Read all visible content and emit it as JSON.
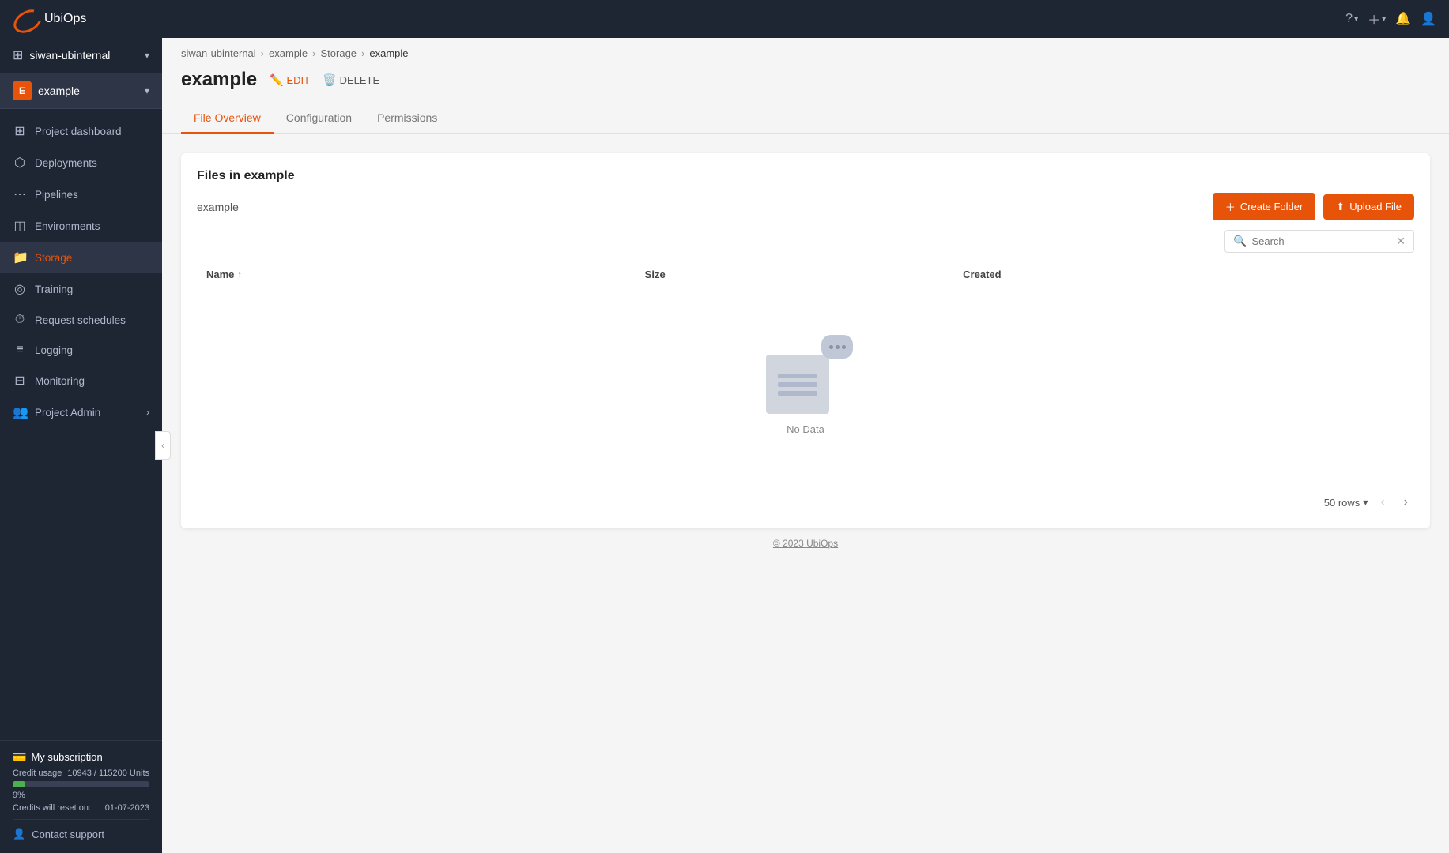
{
  "topnav": {
    "appTitle": "UbiOps",
    "helpLabel": "Help",
    "addLabel": "Add",
    "notificationsLabel": "Notifications",
    "profileLabel": "Profile"
  },
  "sidebar": {
    "orgName": "siwan-ubinternal",
    "projectName": "example",
    "projectInitial": "E",
    "navItems": [
      {
        "id": "project-dashboard",
        "label": "Project dashboard",
        "icon": "⊞"
      },
      {
        "id": "deployments",
        "label": "Deployments",
        "icon": "⬡"
      },
      {
        "id": "pipelines",
        "label": "Pipelines",
        "icon": "⋯"
      },
      {
        "id": "environments",
        "label": "Environments",
        "icon": "◫"
      },
      {
        "id": "storage",
        "label": "Storage",
        "icon": "📁",
        "active": true
      },
      {
        "id": "training",
        "label": "Training",
        "icon": "◎"
      },
      {
        "id": "request-schedules",
        "label": "Request schedules",
        "icon": "⏱"
      },
      {
        "id": "logging",
        "label": "Logging",
        "icon": "≡"
      },
      {
        "id": "monitoring",
        "label": "Monitoring",
        "icon": "⊟"
      },
      {
        "id": "project-admin",
        "label": "Project Admin",
        "icon": "👥",
        "hasChevron": true
      }
    ],
    "subscription": {
      "title": "My subscription",
      "creditLabel": "Credit usage",
      "creditValue": "10943 / 115200 Units",
      "creditPct": "9%",
      "creditFill": 9,
      "resetLabel": "Credits will reset on:",
      "resetDate": "01-07-2023"
    },
    "contactSupport": "Contact support"
  },
  "breadcrumb": {
    "items": [
      "siwan-ubinternal",
      "example",
      "Storage",
      "example"
    ]
  },
  "page": {
    "title": "example",
    "editLabel": "EDIT",
    "deleteLabel": "DELETE"
  },
  "tabs": [
    {
      "id": "file-overview",
      "label": "File Overview",
      "active": true
    },
    {
      "id": "configuration",
      "label": "Configuration",
      "active": false
    },
    {
      "id": "permissions",
      "label": "Permissions",
      "active": false
    }
  ],
  "filesPanel": {
    "title": "Files in example",
    "currentPath": "example",
    "createFolderLabel": "Create Folder",
    "uploadFileLabel": "Upload File",
    "searchPlaceholder": "Search",
    "columns": [
      "Name",
      "Size",
      "Created"
    ],
    "noDataLabel": "No Data",
    "rowsPerPage": "50 rows",
    "rows": []
  },
  "footer": {
    "copyright": "© 2023 UbiOps"
  }
}
